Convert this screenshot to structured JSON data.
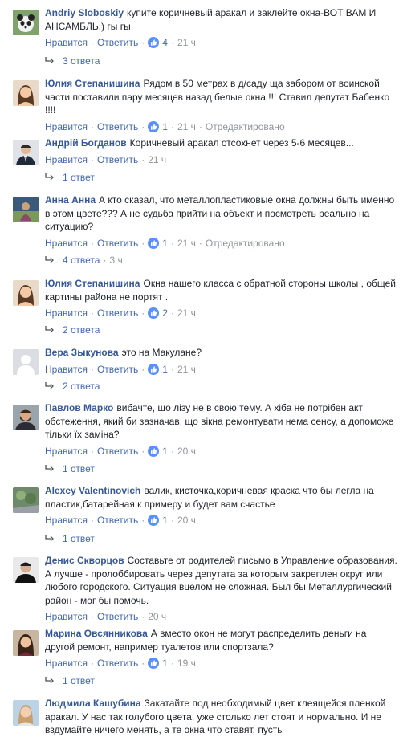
{
  "colors": {
    "link": "#365899",
    "action": "#4267b2",
    "meta": "#90949c",
    "like_badge": "#5890ff"
  },
  "comments": [
    {
      "author": "Andriy Sloboskiy",
      "text": "купите коричневый аракал и заклейте окна-ВОТ ВАМ И АНСАМБЛЬ:) гы гы",
      "like_label": "Нравится",
      "reply_label": "Ответить",
      "likes": "4",
      "time": "21 ч",
      "edited": "",
      "replies_label": "3 ответа",
      "replies_time": "",
      "avatar_icon": "panda-avatar"
    },
    {
      "author": "Юлия Степанишина",
      "text": "Рядом в 50 метрах в д/саду ща забором от воинской части поставили пару месяцев назад белые окна !!! Ставил депутат Бабенко !!!!",
      "like_label": "Нравится",
      "reply_label": "Ответить",
      "likes": "1",
      "time": "21 ч",
      "edited": "Отредактировано",
      "replies_label": "",
      "replies_time": "",
      "avatar_icon": "woman-avatar"
    },
    {
      "author": "Андрій Богданов",
      "text": "Коричневый аракал отсохнет через 5-6 месяцев...",
      "like_label": "Нравится",
      "reply_label": "Ответить",
      "likes": "",
      "time": "21 ч",
      "edited": "",
      "replies_label": "1 ответ",
      "replies_time": "",
      "avatar_icon": "man-suit-avatar"
    },
    {
      "author": "Анна Анна",
      "text": "А кто сказал, что металлопластиковые окна должны быть именно в этом цвете??? А не судьба прийти на объект и посмотреть реально на ситуацию?",
      "like_label": "Нравится",
      "reply_label": "Ответить",
      "likes": "1",
      "time": "21 ч",
      "edited": "Отредактировано",
      "replies_label": "4 ответа",
      "replies_time": "3 ч",
      "avatar_icon": "painting-avatar"
    },
    {
      "author": "Юлия Степанишина",
      "text": "Окна нашего класса с обратной стороны школы , общей картины района не портят .",
      "like_label": "Нравится",
      "reply_label": "Ответить",
      "likes": "2",
      "time": "21 ч",
      "edited": "",
      "replies_label": "2 ответа",
      "replies_time": "",
      "avatar_icon": "woman-avatar"
    },
    {
      "author": "Вера Зыкунова",
      "text": "это на Макулане?",
      "like_label": "Нравится",
      "reply_label": "Ответить",
      "likes": "1",
      "time": "21 ч",
      "edited": "",
      "replies_label": "2 ответа",
      "replies_time": "",
      "avatar_icon": "default-avatar"
    },
    {
      "author": "Павлов Марко",
      "text": "вибачте, що лізу не в свою тему. А хіба не потрібен акт обстеження, який би зазначав, що вікна ремонтувати нема сенсу, а допоможе тільки їх заміна?",
      "like_label": "Нравится",
      "reply_label": "Ответить",
      "likes": "1",
      "time": "20 ч",
      "edited": "",
      "replies_label": "1 ответ",
      "replies_time": "",
      "avatar_icon": "man-beard-avatar"
    },
    {
      "author": "Alexey Valentinovich",
      "text": "валик, кисточка,коричневая краска что бы легла на пластик,батарейная к примеру и будет вам счастье",
      "like_label": "Нравится",
      "reply_label": "Ответить",
      "likes": "1",
      "time": "20 ч",
      "edited": "",
      "replies_label": "1 ответ",
      "replies_time": "",
      "avatar_icon": "nature-avatar"
    },
    {
      "author": "Денис Скворцов",
      "text": "Составьте от родителей письмо в Управление образования. А лучше - пролоббировать через депутата за которым закреплен округ или любого городского. Ситуация вцелом не сложная. Был бы Металлургический район - мог бы помочь.",
      "like_label": "Нравится",
      "reply_label": "Ответить",
      "likes": "",
      "time": "20 ч",
      "edited": "",
      "replies_label": "",
      "replies_time": "",
      "avatar_icon": "man-dark-avatar"
    },
    {
      "author": "Марина Овсянникова",
      "text": "А вместо окон не могут распределить деньги на другой ремонт, например туалетов или спортзала?",
      "like_label": "Нравится",
      "reply_label": "Ответить",
      "likes": "1",
      "time": "19 ч",
      "edited": "",
      "replies_label": "1 ответ",
      "replies_time": "",
      "avatar_icon": "woman-dark-avatar"
    },
    {
      "author": "Людмила Кашубина",
      "text": "Закатайте под необходимый цвет клеящейся пленкой аракал. У нас так голубого цвета, уже столько лет стоят и нормально. И не вздумайте ничего менять, а те окна что ставят, пусть",
      "like_label": "",
      "reply_label": "",
      "likes": "",
      "time": "",
      "edited": "",
      "replies_label": "",
      "replies_time": "",
      "avatar_icon": "woman-light-avatar"
    }
  ]
}
